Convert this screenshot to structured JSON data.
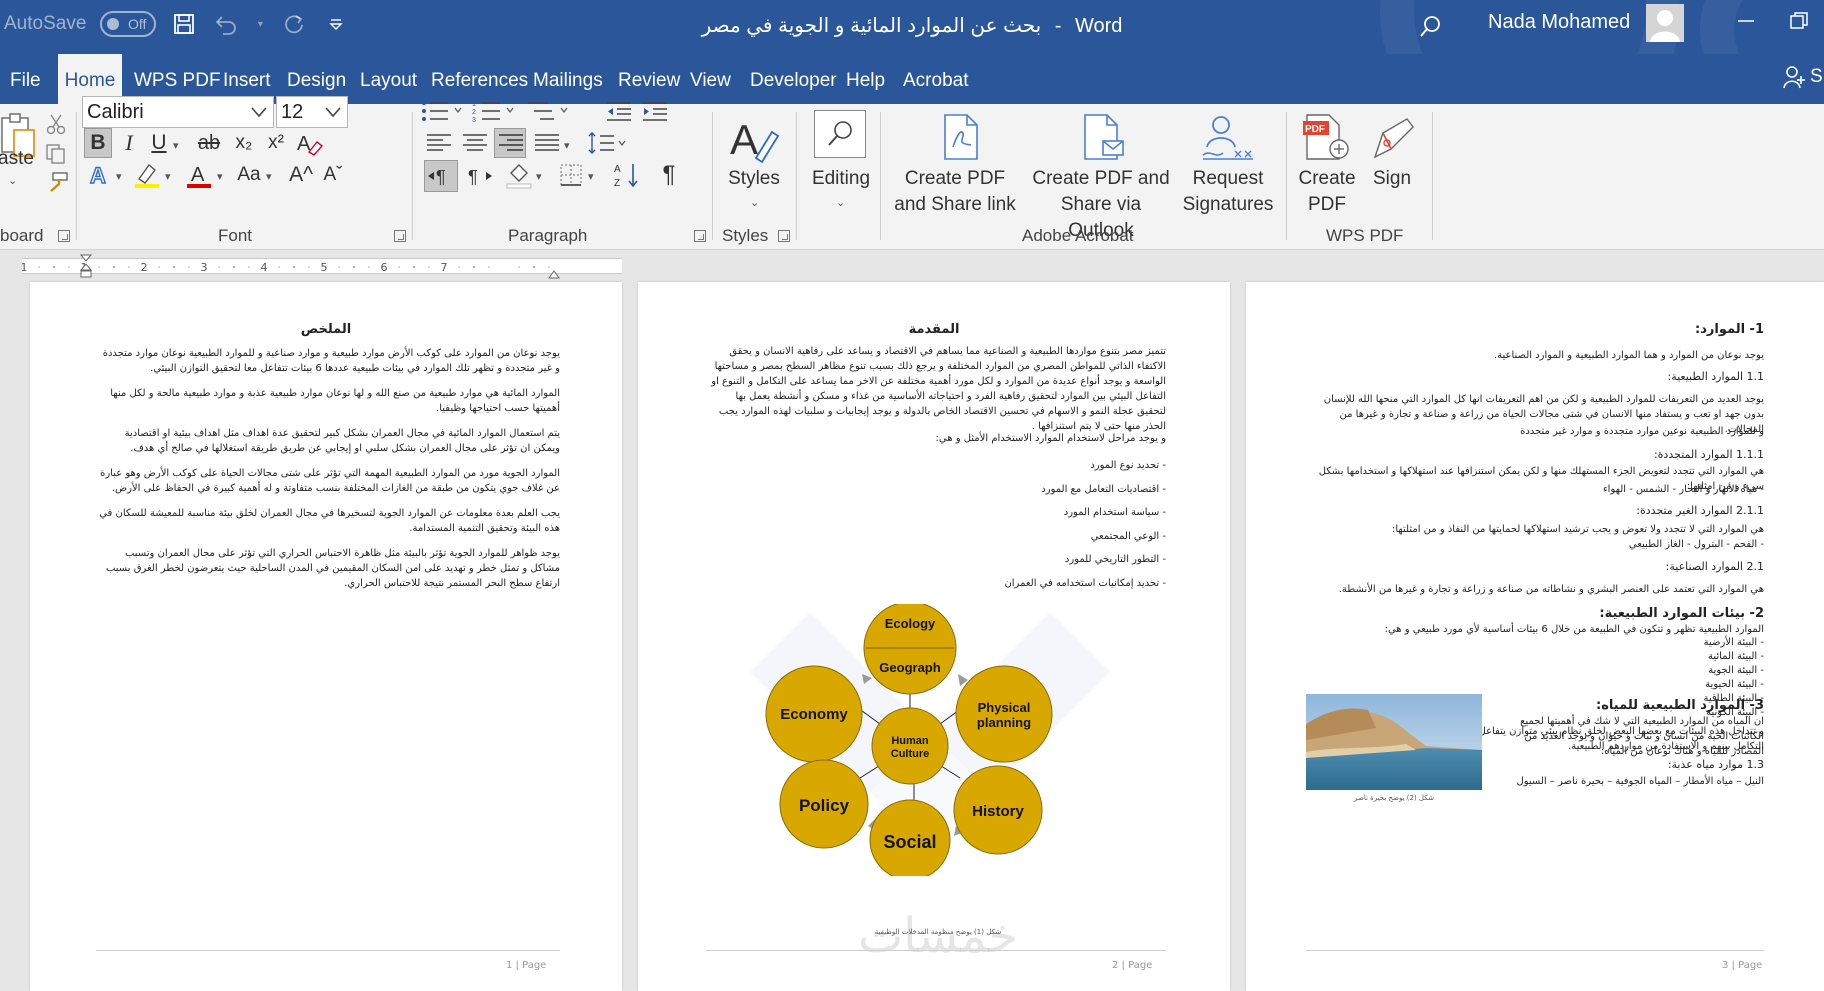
{
  "titlebar": {
    "autosave_label": "AutoSave",
    "autosave_state": "Off",
    "doc_title": "بحث عن الموارد المائية و الجوية في مصر",
    "title_sep": "-",
    "app_name": "Word",
    "user_name": "Nada Mohamed"
  },
  "tabs": [
    "File",
    "Home",
    "WPS PDF",
    "Insert",
    "Design",
    "Layout",
    "References",
    "Mailings",
    "Review",
    "View",
    "Developer",
    "Help",
    "Acrobat"
  ],
  "tabs_right_label": "S",
  "ribbon": {
    "clipboard": {
      "paste_label": "aste",
      "group_label": "board"
    },
    "font": {
      "font_name": "Calibri",
      "font_size": "12",
      "group_label": "Font",
      "bold": "B",
      "italic": "I",
      "underline": "U",
      "strike": "ab",
      "subscript": "x₂",
      "superscript": "x²",
      "case": "Aa",
      "grow": "A^",
      "shrink": "Aˇ"
    },
    "paragraph": {
      "group_label": "Paragraph",
      "pilcrow": "¶"
    },
    "styles": {
      "label": "Styles",
      "group_label": "Styles"
    },
    "editing": {
      "label": "Editing"
    },
    "acrobat": {
      "create_share_line1": "Create PDF",
      "create_share_line2": "and Share link",
      "create_outlook_line1": "Create PDF and",
      "create_outlook_line2": "Share via Outlook",
      "request_line1": "Request",
      "request_line2": "Signatures",
      "group_label": "Adobe Acrobat"
    },
    "wps": {
      "create_line1": "Create",
      "create_line2": "PDF",
      "sign": "Sign",
      "group_label": "WPS PDF",
      "pdf_badge": "PDF"
    }
  },
  "ruler": {
    "numbers": [
      "1",
      "1",
      "2",
      "3",
      "4",
      "5",
      "6",
      "7"
    ]
  },
  "pages": [
    {
      "heading": "الملخص",
      "paragraphs": [
        "يوجد نوعان من الموارد على كوكب الأرض موارد طبيعية و موارد صناعية و للموارد الطبيعية نوعان موارد متجددة و غير متجددة و تظهر تلك الموارد في بيئات طبيعية عددها 6 بيئات تتفاعل معا لتحقيق التوازن البيئي.",
        "الموارد المائية هي موارد طبيعية من صنع الله و لها نوعان موارد طبيعية عذبة و موارد طبيعية مالحة و لكل منها أهميتها حسب احتياجها وظيفيا.",
        "يتم استعمال الموارد المائية في مجال العمران بشكل كبير لتحقيق عدة اهداف مثل اهداف بيئية او اقتصادية ويمكن ان تؤثر على مجال العمران بشكل سلبي او إيجابي عن طريق طريقة استغلالها في صالح أي هدف.",
        "الموارد الجوية مورد من الموارد الطبيعية المهمة التي تؤثر على شتى مجالات الحياة على كوكب الأرض وهو عبارة عن غلاف جوي يتكون من طبقة من الغازات المختلفة بنسب متفاوتة و له أهمية كبيرة في الحفاظ على الأرض.",
        "يجب العلم بعدة معلومات عن الموارد الجوية لتسخيرها في مجال العمران لخلق بيئة مناسبة للمعيشة للسكان في هذه البيئة وتحقيق التنمية المستدامة.",
        "يوجد ظواهر للموارد الجوية تؤثر بالبيئة مثل ظاهرة الاحتباس الحراري التي تؤثر على مجال العمران وتسبب مشاكل و تمثل خطر و تهديد على امن السكان المقيمين في المدن الساحلية حيث يتعرضون لخطر الغرق بسبب ارتفاع سطح البحر المستمر نتيجة للاحتباس الحراري."
      ],
      "footer_num": "1",
      "footer_word": "Page"
    },
    {
      "heading": "المقدمة",
      "paragraphs": [
        "تتميز مصر بتنوع مواردها الطبيعية و الصناعية مما يساهم في الاقتصاد و يساعد على رفاهية الانسان و يحقق الاكتفاء الذاتي للمواطن المصري من الموارد المختلفة و يرجع ذلك بسبب تنوع مظاهر السطح بمصر و مساحتها الواسعة و يوجد أنواع عديدة من الموارد و لكل مورد أهمية مختلفة عن الاخر مما يساعد على التكامل و التنوع او التفاعل البيئي بين الموارد لتحقيق رفاهية الفرد و احتياجاته الأساسية من غذاء و مسكن و أنشطة يعمل بها لتحقيق عجلة النمو و الاسهام في تحسين الاقتصاد الخاص بالدولة و يوجد إيجابيات و سلبيات لهذه الموارد يجب الحذر منها حتى لا يتم استنزافها .",
        "و يوجد مراحل لاستخدام الموارد الاستخدام الأمثل و هي:"
      ],
      "bullets": [
        "تحديد نوع المورد",
        "اقتصاديات التعامل مع المورد",
        "سياسة استخدام المورد",
        "الوعي المجتمعي",
        "التطور التاريخي للمورد",
        "تحديد إمكانيات استخدامه في العمران"
      ],
      "diagram_nodes": [
        "Ecology",
        "Geograph",
        "Economy",
        "Physical planning",
        "Human Culture",
        "Policy",
        "History",
        "Social"
      ],
      "caption": "شكل (1) يوضح منظومة المدخلات الوظيفية",
      "watermark": "خمسات",
      "footer_num": "2",
      "footer_word": "Page"
    },
    {
      "h1": "1- الموارد:",
      "p1": "يوجد نوعان من الموارد و هما الموارد الطبيعية و الموارد الصناعية.",
      "h11": "1.1 الموارد الطبيعية:",
      "p11": "يوجد العديد من التعريفات للموارد الطبيعية و لكن من اهم التعريفات انها كل الموارد التي منحها الله للإنسان بدون جهد او تعب و يستفاد منها الانسان في شتى مجالات الحياة من زراعة و صناعة و تجارة و غيرها من المجالات.",
      "p11b": "و للموارد الطبيعية نوعين موارد متجددة و موارد غير متجددة",
      "h111": "1.1.1 الموارد المتجددة:",
      "p111": "هي الموارد التي تتجدد لتعويض الجزء المستهلك منها و لكن يمكن استنزافها عند استهلاكها و استخدامها بشكل سيء و من امثلتها:",
      "p111list": "- مياه الأنهار و البحار      - الشمس      - الهواء",
      "h211": "2.1.1 الموارد الغير متجددة:",
      "p211": "هي الموارد التي لا تتجدد ولا تعوض و يجب ترشيد استهلاكها لحمايتها من النفاذ و من امثلتها:",
      "p211list": "- الفحم      - البترول      - الغاز الطبيعي",
      "h21": "2.1 الموارد الصناعية:",
      "p21": "هي الموارد التي تعتمد على العنصر البشري و نشاطاته من صناعة و زراعة و تجارة و غيرها من الأنشطة.",
      "h2": "2- بيئات الموارد الطبيعية:",
      "p2": "الموارد الطبيعية تظهر و تتكون في الطبيعة من خلال 6 بيئات أساسية لأي مورد طبيعي و هي:",
      "envs": [
        "البيئة الأرضية",
        "البيئة المائية",
        "البيئة الجوية",
        "البيئة الحيوية",
        "البيئة الطاقية",
        "البيئة الكونية"
      ],
      "p2b": "و تتداخل هذه البيئات مع بعضها البعض لخلق نظام بيئي متوازن يتفاعل به تلك البيئات مع بعضها بهدف تحقيق التكامل بينهم و الاستفادة من مواردهم الطبيعية.",
      "h3": "3- الموارد الطبيعية للمياه:",
      "p3": "ان المياه من الموارد الطبيعية التي لا شك في أهميتها لجميع الكائنات الحية من انسان و نبات و حيوان و يوجد العديد من المصادر للمياه و هناك نوعان من المياه:",
      "h31": "1.3 موارد مياه عذبة:",
      "p31": "النيل – مياه الأمطار – المياه الجوفية – بحيرة ناصر – السيول",
      "caption": "شكل (2) يوضح بحيرة ناصر",
      "footer_num": "3",
      "footer_word": "Page"
    }
  ],
  "colors": {
    "word_blue": "#2b579a",
    "node_gold": "#d9a800",
    "node_border": "#8a6a00"
  }
}
